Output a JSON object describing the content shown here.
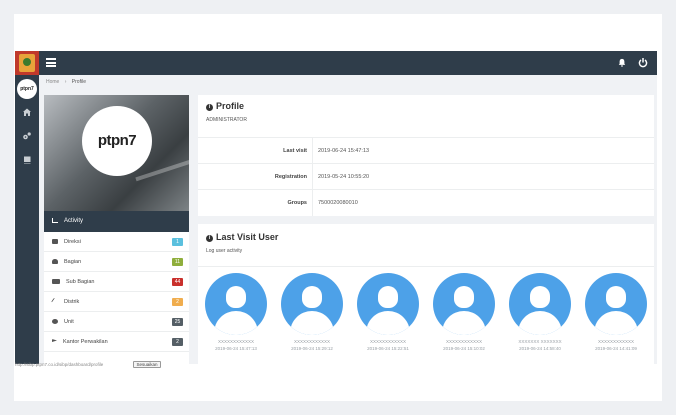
{
  "header": {
    "logo_text": "ptpn7"
  },
  "breadcrumb": {
    "home": "Home",
    "sep": "›",
    "current": "Profile"
  },
  "hero": {
    "logo_text": "ptpn7"
  },
  "activity": {
    "title": "Activity",
    "items": [
      {
        "label": "Direksi",
        "count": "1",
        "color": "#5bc0de"
      },
      {
        "label": "Bagian",
        "count": "11",
        "color": "#8fae3c"
      },
      {
        "label": "Sub Bagian",
        "count": "44",
        "color": "#c9302c"
      },
      {
        "label": "Distrik",
        "count": "2",
        "color": "#f0ad4e"
      },
      {
        "label": "Unit",
        "count": "25",
        "color": "#555f66"
      },
      {
        "label": "Kantor Perwakilan",
        "count": "2",
        "color": "#555f66"
      }
    ]
  },
  "profile": {
    "title": "Profile",
    "role": "ADMINISTRATOR",
    "rows": [
      {
        "key": "Last visit",
        "value": "2019-06-24 15:47:13"
      },
      {
        "key": "Registration",
        "value": "2019-05-24 10:55:20"
      },
      {
        "key": "Groups",
        "value": "7500020080010"
      }
    ]
  },
  "last_visit": {
    "title": "Last Visit User",
    "subtitle": "Log user activity",
    "users": [
      {
        "name": "XXXXXXXXXXXX",
        "time": "2019-06-24 15:47:13"
      },
      {
        "name": "XXXXXXXXXXXX",
        "time": "2019-06-24 15:29:12"
      },
      {
        "name": "XXXXXXXXXXXX",
        "time": "2019-06-24 15:22:51"
      },
      {
        "name": "XXXXXXXXXXXX",
        "time": "2019-06-24 15:10:02"
      },
      {
        "name": "XXXXXXX XXXXXXX",
        "time": "2019-06-24 14:58:40"
      },
      {
        "name": "XXXXXXXXXXXX",
        "time": "2019-06-24 14:41:09"
      }
    ]
  },
  "footer": {
    "text": "http://sibp.ptpn7.co.id/sibp/dashboard/profile",
    "button": "Sesuaikan"
  }
}
